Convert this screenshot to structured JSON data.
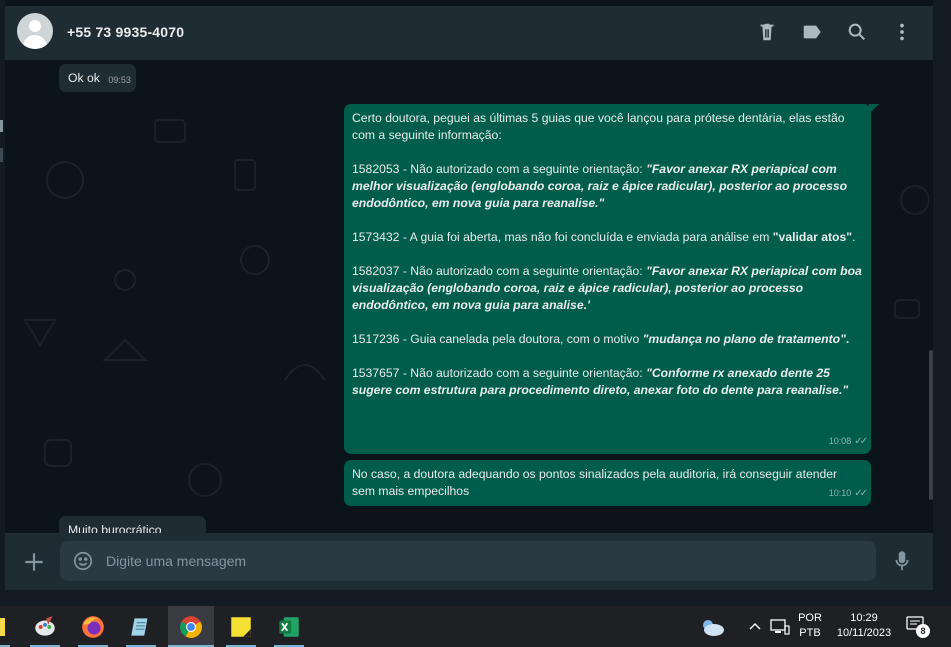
{
  "header": {
    "contact_name": "+55 73 9935-4070",
    "icons": [
      "delete-icon",
      "label-icon",
      "search-icon",
      "more-vertical-icon"
    ]
  },
  "messages": {
    "okok": {
      "text": "Ok ok",
      "time": "09:53"
    },
    "long": {
      "intro": "Certo doutora, peguei as últimas 5 guias que você lançou para prótese dentária, elas estão com a seguinte informação:",
      "item1_prefix": "1582053 - Não autorizado com a seguinte orientação: ",
      "item1_bold": "\"Favor anexar RX periapical com melhor visualização (englobando coroa, raiz e ápice radicular), posterior ao processo endodôntico, em nova guia para reanalise.\"",
      "item2_prefix": "1573432 - A guia foi aberta, mas não foi concluída e enviada para análise em ",
      "item2_bold": "\"validar atos\"",
      "item2_suffix": ".",
      "item3_prefix": "1582037 - Não autorizado com a seguinte orientação: ",
      "item3_bold": "\"Favor anexar RX periapical com boa visualização (englobando coroa, raiz e ápice radicular), posterior ao processo endodôntico, em nova guia para analise.'",
      "item4_prefix": "1517236 - Guia canelada pela doutora, com o motivo ",
      "item4_bold": "\"mudança no plano de tratamento\"",
      "item4_suffix": ".",
      "item5_prefix": "1537657 - Não autorizado com a seguinte orientação: ",
      "item5_bold": "\"Conforme rx anexado dente 25 sugere com estrutura para procedimento direto, anexar foto do dente para reanalise.\"",
      "time": "10:08"
    },
    "short": {
      "text": "No caso, a doutora adequando os pontos sinalizados pela auditoria, irá conseguir atender sem mais empecilhos",
      "time": "10:10"
    },
    "cut": {
      "text": "Muito burocrático"
    }
  },
  "composer": {
    "placeholder": "Digite uma mensagem"
  },
  "taskbar": {
    "apps": [
      "sticky-app-icon",
      "paint-icon",
      "firefox-icon",
      "notepad-icon",
      "chrome-icon",
      "sticky-notes-icon",
      "excel-icon"
    ],
    "language_line1": "POR",
    "language_line2": "PTB",
    "clock_time": "10:29",
    "clock_date": "10/11/2023",
    "notification_count": "8"
  },
  "colors": {
    "header_bg": "#202c33",
    "chat_bg": "#0b141a",
    "incoming_bubble": "#202c33",
    "outgoing_bubble": "#005c4b",
    "text": "#e9edef",
    "icon": "#aebac1"
  }
}
